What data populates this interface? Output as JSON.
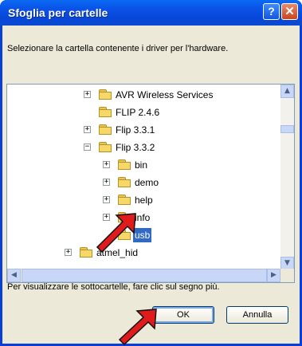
{
  "window": {
    "title": "Sfoglia per cartelle",
    "help_glyph": "?",
    "close_glyph": "✕"
  },
  "instruction": "Selezionare la cartella contenente i driver per l'hardware.",
  "tree": {
    "items": [
      {
        "label": "AVR Wireless Services",
        "expander": "+",
        "selected": false
      },
      {
        "label": "FLIP 2.4.6",
        "expander": "",
        "selected": false
      },
      {
        "label": "Flip 3.3.1",
        "expander": "+",
        "selected": false
      },
      {
        "label": "Flip 3.3.2",
        "expander": "−",
        "selected": false
      },
      {
        "label": "bin",
        "expander": "+",
        "selected": false
      },
      {
        "label": "demo",
        "expander": "+",
        "selected": false
      },
      {
        "label": "help",
        "expander": "+",
        "selected": false
      },
      {
        "label": "info",
        "expander": "+",
        "selected": false
      },
      {
        "label": "usb",
        "expander": "",
        "selected": true
      },
      {
        "label": "atmel_hid",
        "expander": "+",
        "selected": false
      }
    ]
  },
  "scroll": {
    "up": "▲",
    "down": "▼",
    "left": "◀",
    "right": "▶"
  },
  "hint": "Per visualizzare le sottocartelle, fare clic sul segno più.",
  "buttons": {
    "ok": "OK",
    "cancel": "Annulla"
  },
  "colors": {
    "titlebar": "#0a55e8",
    "selection": "#316ac5",
    "annotation_arrow": "#e01b1b"
  }
}
